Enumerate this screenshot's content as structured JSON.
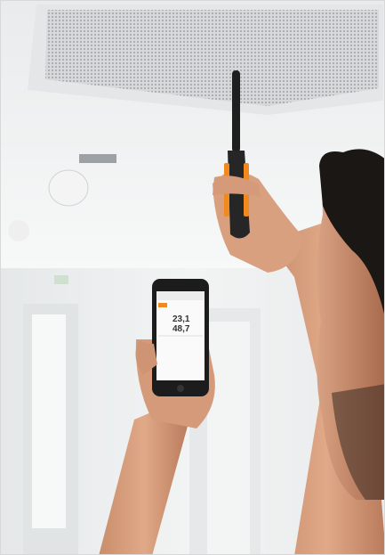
{
  "phone": {
    "readings": [
      "23,1",
      "48,7"
    ],
    "screen_header_color": "#ececec",
    "accent": "#f08a1e"
  },
  "device": {
    "body_color": "#262626",
    "accent": "#f08a1e"
  },
  "scene": {
    "wall_color": "#eef0f1",
    "ceiling_color": "#f6f7f7",
    "vent_color": "#dfe1e2"
  }
}
